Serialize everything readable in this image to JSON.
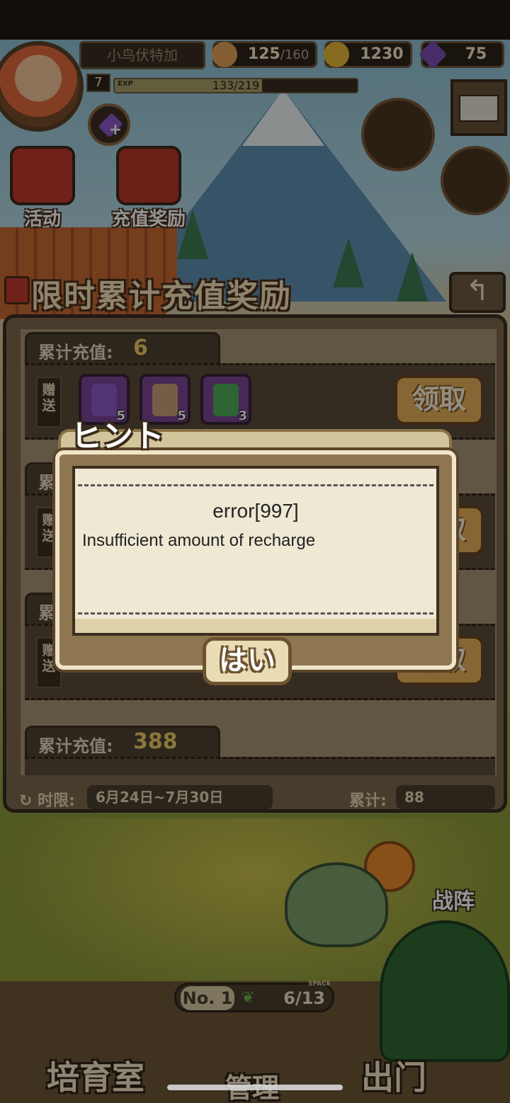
{
  "hud": {
    "player_name": "小鸟伏特加",
    "stamina_current": "125",
    "stamina_max": "/160",
    "gold": "1230",
    "gems": "75",
    "level": "7",
    "exp_label": "EXP",
    "exp_text": "133/219",
    "exp_progress": 0.607
  },
  "shortcuts": {
    "events_label": "活动",
    "recharge_reward_label": "充值奖励"
  },
  "panel": {
    "title": "限时累计充值奖励",
    "tier_label": "累计充值:",
    "gift_tag": "赠送",
    "tiers": [
      {
        "amount": "6",
        "claim_label": "领取",
        "items": [
          {
            "count": "5",
            "color": "#8e5ac8",
            "icon": "potion-icon"
          },
          {
            "count": "5",
            "color": "#c7a07a",
            "icon": "ticket-icon"
          },
          {
            "count": "3",
            "color": "#4fae5a",
            "icon": "book-icon"
          }
        ]
      },
      {
        "amount": "",
        "claim_label": "领取"
      },
      {
        "amount": "",
        "claim_label": "领取"
      },
      {
        "amount": "388"
      }
    ],
    "period_label": "时限:",
    "period_value": "6月24日~7月30日",
    "total_label": "累计:",
    "total_value": "88"
  },
  "dialog": {
    "title": "ヒント",
    "error_code": "error[997]",
    "message": "Insufficient amount of recharge",
    "ok_label": "はい"
  },
  "field": {
    "formation_label": "战阵",
    "rank": "No. 1",
    "space_label": "SPACE",
    "space_value": "6/13"
  },
  "nav": {
    "left": "培育室",
    "center": "管理",
    "right": "出门"
  },
  "colors": {
    "gold_accent": "#efcc6a",
    "claim_button": "#e7b25a",
    "item_frame": "#7a4594"
  }
}
